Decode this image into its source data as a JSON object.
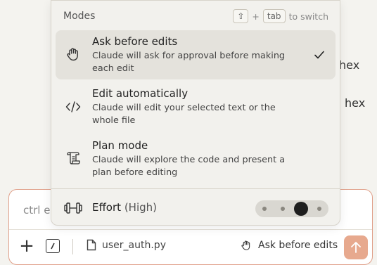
{
  "background": {
    "line1": "hex",
    "line2": "hex"
  },
  "popup": {
    "title": "Modes",
    "shortcut": {
      "key1": "⇧",
      "plus": "+",
      "key2": "tab",
      "suffix": "to switch"
    },
    "modes": [
      {
        "name": "Ask before edits",
        "desc": "Claude will ask for approval before making each edit",
        "icon": "hand-icon",
        "selected": true
      },
      {
        "name": "Edit automatically",
        "desc": "Claude will edit your selected text or the whole file",
        "icon": "code-icon",
        "selected": false
      },
      {
        "name": "Plan mode",
        "desc": "Claude will explore the code and present a plan before editing",
        "icon": "scroll-icon",
        "selected": false
      }
    ],
    "effort": {
      "label": "Effort",
      "level": "(High)",
      "icon": "dumbbell-icon",
      "steps": 4,
      "selected_step": 3
    }
  },
  "composer": {
    "placeholder": "ctrl e",
    "file_name": "user_auth.py",
    "mode_label": "Ask before edits"
  },
  "colors": {
    "accent": "#e7a98e",
    "border": "#e0a08a"
  }
}
